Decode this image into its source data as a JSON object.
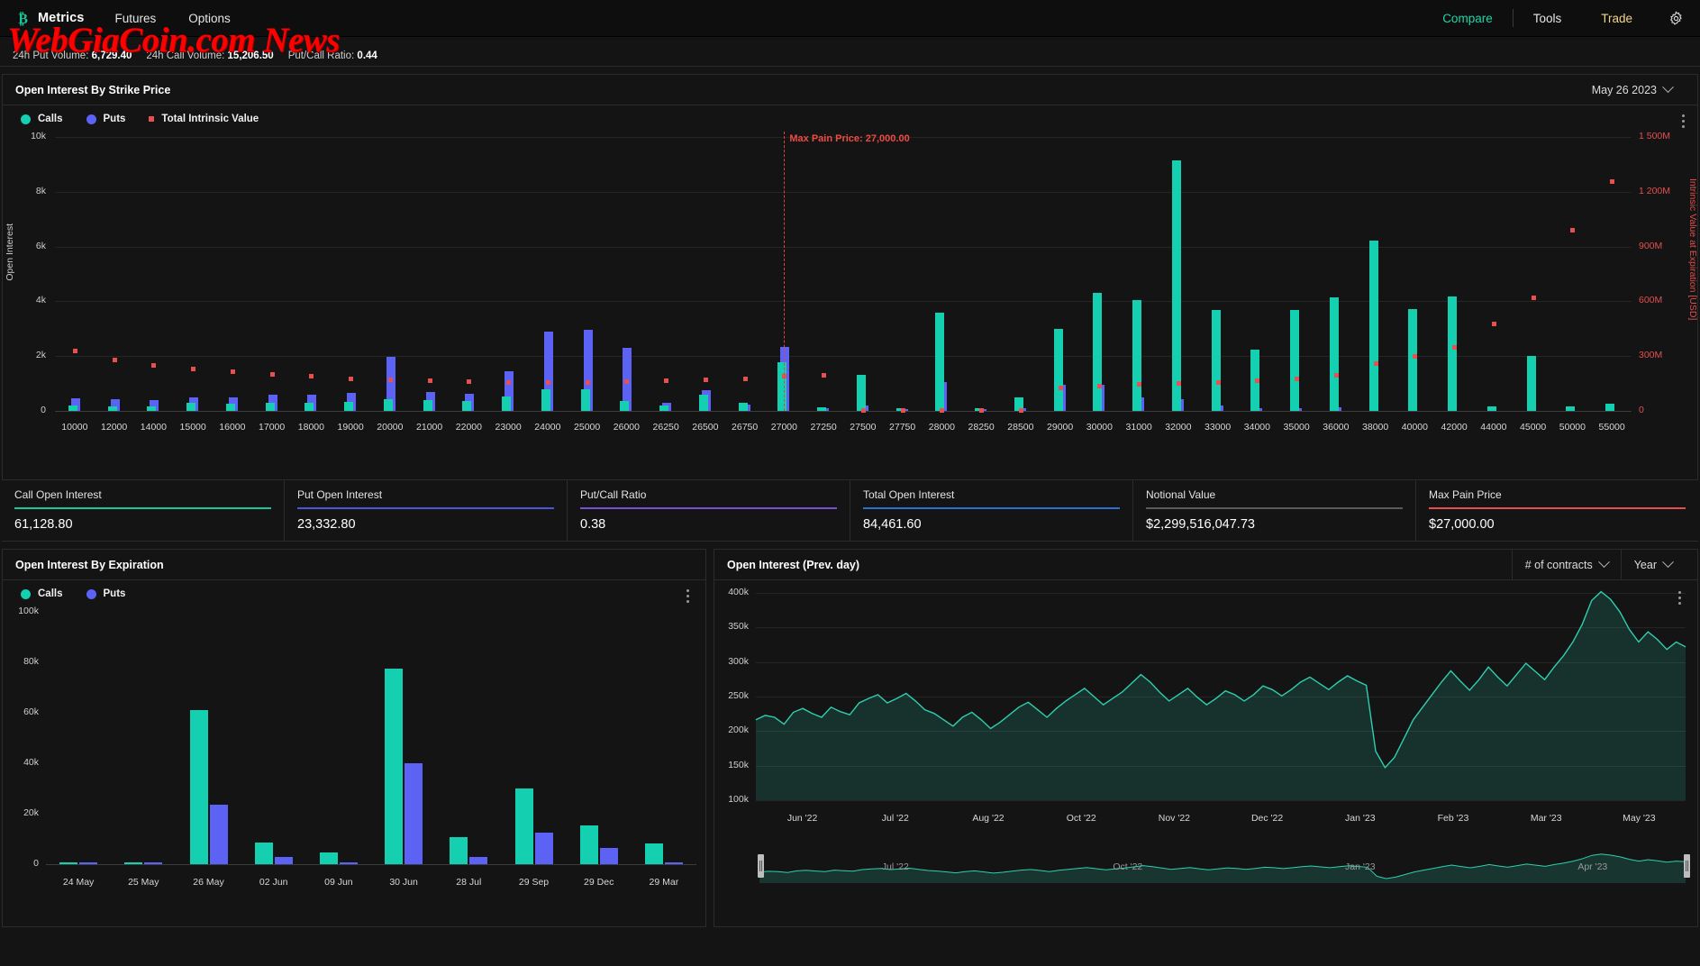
{
  "nav": {
    "brand": "Metrics",
    "brand_logo_icon": "bitcoin-icon",
    "links": [
      "Futures",
      "Options"
    ],
    "right": [
      {
        "label": "Compare",
        "color": "#1fd7a8"
      },
      {
        "label": "Tools",
        "color": "#e6e6e6"
      },
      {
        "label": "Trade",
        "color": "#f0d68a"
      }
    ],
    "gear_icon": "gear-icon"
  },
  "watermark": "WebGiaCoin.com News",
  "volume_strip": {
    "put_volume_label": "24h Put Volume:",
    "put_volume_value": "6,729.40",
    "call_volume_label": "24h Call Volume:",
    "call_volume_value": "15,206.50",
    "put_call_ratio_label": "Put/Call Ratio:",
    "put_call_ratio_value": "0.44"
  },
  "strike_panel": {
    "title": "Open Interest By Strike Price",
    "date_selector": "May 26 2023",
    "menu_icon": "kebab-menu-icon",
    "legend": [
      {
        "label": "Calls",
        "color": "#14cfb0",
        "shape": "circle"
      },
      {
        "label": "Puts",
        "color": "#5b62f4",
        "shape": "circle"
      },
      {
        "label": "Total Intrinsic Value",
        "color": "#e8504f",
        "shape": "square"
      }
    ]
  },
  "metrics": [
    {
      "label": "Call Open Interest",
      "value": "61,128.80",
      "color": "#16c79a"
    },
    {
      "label": "Put Open Interest",
      "value": "23,332.80",
      "color": "#4a56d6"
    },
    {
      "label": "Put/Call Ratio",
      "value": "0.38",
      "color": "#7a4fd6"
    },
    {
      "label": "Total Open Interest",
      "value": "84,461.60",
      "color": "#2c6fd1"
    },
    {
      "label": "Notional Value",
      "value": "$2,299,516,047.73",
      "color": "#5a5a5a"
    },
    {
      "label": "Max Pain Price",
      "value": "$27,000.00",
      "color": "#e05050"
    }
  ],
  "expiration_panel": {
    "title": "Open Interest By Expiration",
    "menu_icon": "kebab-menu-icon",
    "legend": [
      {
        "label": "Calls",
        "color": "#14cfb0",
        "shape": "circle"
      },
      {
        "label": "Puts",
        "color": "#5b62f4",
        "shape": "circle"
      }
    ]
  },
  "prev_day_panel": {
    "title": "Open Interest (Prev. day)",
    "contracts_selector": "# of contracts",
    "period_selector": "Year",
    "menu_icon": "kebab-menu-icon"
  },
  "chart_data": [
    {
      "type": "bar",
      "name": "open-interest-by-strike-price",
      "title": "Open Interest By Strike Price",
      "xlabel": "",
      "ylabel": "Open Interest",
      "y2label": "Intrinsic Value at Expiration [USD]",
      "ylim": [
        0,
        10000
      ],
      "yticks": [
        "0",
        "2k",
        "4k",
        "6k",
        "8k",
        "10k"
      ],
      "y2lim": [
        0,
        1500000000
      ],
      "y2ticks": [
        "0",
        "300M",
        "600M",
        "900M",
        "1 200M",
        "1 500M"
      ],
      "grid": true,
      "legend_position": "top-left",
      "categories": [
        "10000",
        "12000",
        "14000",
        "15000",
        "16000",
        "17000",
        "18000",
        "19000",
        "20000",
        "21000",
        "22000",
        "23000",
        "24000",
        "25000",
        "26000",
        "26250",
        "26500",
        "26750",
        "27000",
        "27250",
        "27500",
        "27750",
        "28000",
        "28250",
        "28500",
        "29000",
        "30000",
        "31000",
        "32000",
        "33000",
        "34000",
        "35000",
        "36000",
        "38000",
        "40000",
        "42000",
        "44000",
        "45000",
        "50000",
        "55000"
      ],
      "series": [
        {
          "name": "Calls",
          "color": "#14cfb0",
          "values": [
            190,
            180,
            170,
            290,
            260,
            300,
            290,
            340,
            420,
            400,
            350,
            530,
            790,
            790,
            370,
            200,
            580,
            300,
            1780,
            120,
            1320,
            110,
            3590,
            110,
            480,
            2980,
            4320,
            4050,
            9150,
            3700,
            2250,
            3680,
            4130,
            6230,
            3720,
            4180,
            180,
            2000,
            150,
            260
          ]
        },
        {
          "name": "Puts",
          "color": "#5b62f4",
          "values": [
            460,
            430,
            400,
            500,
            480,
            600,
            590,
            660,
            1970,
            700,
            630,
            1460,
            2890,
            2960,
            2310,
            310,
            760,
            230,
            2330,
            100,
            200,
            60,
            1060,
            60,
            90,
            950,
            960,
            500,
            420,
            200,
            110,
            90,
            120,
            0,
            0,
            0,
            0,
            0,
            0,
            0
          ]
        },
        {
          "name": "Total Intrinsic Value",
          "color": "#e8504f",
          "type": "scatter",
          "axis": "y2",
          "values": [
            330000000,
            280000000,
            250000000,
            230000000,
            215000000,
            200000000,
            190000000,
            180000000,
            175000000,
            170000000,
            165000000,
            160000000,
            160000000,
            160000000,
            165000000,
            170000000,
            175000000,
            180000000,
            190000000,
            195000000,
            5000000,
            5000000,
            5000000,
            5000000,
            5000000,
            130000000,
            140000000,
            150000000,
            155000000,
            160000000,
            170000000,
            180000000,
            195000000,
            260000000,
            300000000,
            350000000,
            480000000,
            620000000,
            990000000,
            1260000000
          ]
        }
      ],
      "annotations": [
        {
          "label": "Max Pain Price: 27,000.00",
          "x": "27000",
          "color": "#ef4b42",
          "style": "dashed-vline"
        }
      ]
    },
    {
      "type": "bar",
      "name": "open-interest-by-expiration",
      "title": "Open Interest By Expiration",
      "xlabel": "",
      "ylabel": "",
      "ylim": [
        0,
        100000
      ],
      "yticks": [
        "0",
        "20k",
        "40k",
        "60k",
        "80k",
        "100k"
      ],
      "grid": false,
      "legend_position": "top-left",
      "categories": [
        "24 May",
        "25 May",
        "26 May",
        "02 Jun",
        "09 Jun",
        "30 Jun",
        "28 Jul",
        "29 Sep",
        "29 Dec",
        "29 Mar"
      ],
      "series": [
        {
          "name": "Calls",
          "color": "#14cfb0",
          "values": [
            400,
            500,
            61000,
            8500,
            4800,
            77500,
            10800,
            30000,
            15500,
            8200
          ]
        },
        {
          "name": "Puts",
          "color": "#5b62f4",
          "values": [
            300,
            300,
            23500,
            2900,
            600,
            40000,
            2800,
            12500,
            6600,
            800
          ]
        }
      ]
    },
    {
      "type": "area",
      "name": "open-interest-prev-day",
      "title": "Open Interest (Prev. day)",
      "xlabel": "",
      "ylabel": "",
      "ylim": [
        100000,
        430000
      ],
      "yticks": [
        "100k",
        "150k",
        "200k",
        "250k",
        "300k",
        "350k",
        "400k"
      ],
      "grid": true,
      "line_color": "#2ecfb0",
      "fill_color": "rgba(46,207,176,0.16)",
      "xticks": [
        "Jun '22",
        "Jul '22",
        "Aug '22",
        "Oct '22",
        "Nov '22",
        "Dec '22",
        "Jan '23",
        "Feb '23",
        "Mar '23",
        "May '23"
      ],
      "navigator_xticks": [
        "Jul '22",
        "Oct '22",
        "Jan '23",
        "Apr '23"
      ],
      "x": [
        0,
        1,
        2,
        3,
        4,
        5,
        6,
        7,
        8,
        9,
        10,
        11,
        12,
        13,
        14,
        15,
        16,
        17,
        18,
        19,
        20,
        21,
        22,
        23,
        24,
        25,
        26,
        27,
        28,
        29,
        30,
        31,
        32,
        33,
        34,
        35,
        36,
        37,
        38,
        39,
        40,
        41,
        42,
        43,
        44,
        45,
        46,
        47,
        48,
        49,
        50,
        51,
        52,
        53,
        54,
        55,
        56,
        57,
        58,
        59,
        60,
        61,
        62,
        63,
        64,
        65,
        66,
        67,
        68,
        69,
        70,
        71,
        72,
        73,
        74,
        75,
        76,
        77,
        78,
        79,
        80,
        81,
        82,
        83,
        84,
        85,
        86,
        87,
        88,
        89,
        90,
        91,
        92,
        93,
        94,
        95,
        96,
        97,
        98,
        99
      ],
      "values": [
        228000,
        235000,
        232000,
        221000,
        240000,
        246000,
        238000,
        232000,
        248000,
        241000,
        236000,
        255000,
        262000,
        268000,
        255000,
        262000,
        270000,
        258000,
        244000,
        238000,
        228000,
        218000,
        232000,
        240000,
        228000,
        214000,
        224000,
        236000,
        248000,
        256000,
        244000,
        232000,
        246000,
        258000,
        268000,
        278000,
        265000,
        252000,
        262000,
        272000,
        286000,
        300000,
        288000,
        272000,
        258000,
        268000,
        278000,
        264000,
        252000,
        262000,
        274000,
        268000,
        258000,
        268000,
        282000,
        276000,
        266000,
        276000,
        288000,
        296000,
        286000,
        276000,
        288000,
        298000,
        290000,
        283000,
        178000,
        152000,
        168000,
        198000,
        228000,
        248000,
        268000,
        288000,
        306000,
        290000,
        275000,
        292000,
        312000,
        296000,
        282000,
        300000,
        318000,
        305000,
        292000,
        312000,
        330000,
        352000,
        380000,
        418000,
        432000,
        420000,
        400000,
        372000,
        352000,
        368000,
        356000,
        340000,
        352000,
        344000
      ]
    }
  ]
}
